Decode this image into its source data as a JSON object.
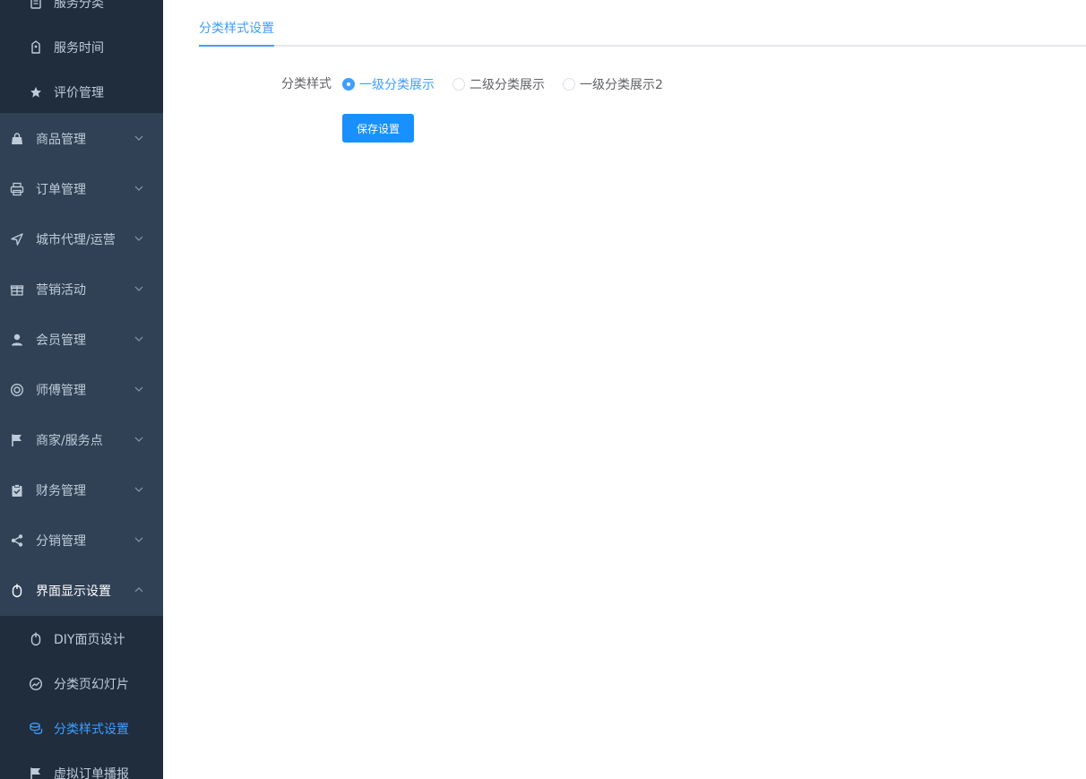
{
  "sidebar": {
    "sub_top": [
      {
        "label": "服务分类",
        "icon": "document-icon"
      },
      {
        "label": "服务时间",
        "icon": "clock-icon"
      },
      {
        "label": "评价管理",
        "icon": "star-icon"
      }
    ],
    "menu": [
      {
        "label": "商品管理",
        "icon": "shopping-bag-icon"
      },
      {
        "label": "订单管理",
        "icon": "printer-icon"
      },
      {
        "label": "城市代理/运营",
        "icon": "navigation-icon"
      },
      {
        "label": "营销活动",
        "icon": "gift-icon"
      },
      {
        "label": "会员管理",
        "icon": "user-icon"
      },
      {
        "label": "师傅管理",
        "icon": "lifebuoy-icon"
      },
      {
        "label": "商家/服务点",
        "icon": "flag-icon"
      },
      {
        "label": "财务管理",
        "icon": "clipboard-check-icon"
      },
      {
        "label": "分销管理",
        "icon": "share-icon"
      },
      {
        "label": "界面显示设置",
        "icon": "mouse-icon"
      }
    ],
    "sub_bottom": [
      {
        "label": "DIY面页设计",
        "icon": "mouse-icon"
      },
      {
        "label": "分类页幻灯片",
        "icon": "dashboard-icon"
      },
      {
        "label": "分类样式设置",
        "icon": "coins-icon"
      },
      {
        "label": "虚拟订单播报",
        "icon": "flag-icon"
      }
    ]
  },
  "main": {
    "tab_label": "分类样式设置",
    "form": {
      "label": "分类样式",
      "options": [
        "一级分类展示",
        "二级分类展示",
        "一级分类展示2"
      ],
      "selected": "一级分类展示"
    },
    "save_label": "保存设置"
  },
  "colors": {
    "sidebar_bg": "#304156",
    "submenu_bg": "#1f2d3d",
    "accent": "#409eff",
    "button": "#1890ff"
  }
}
